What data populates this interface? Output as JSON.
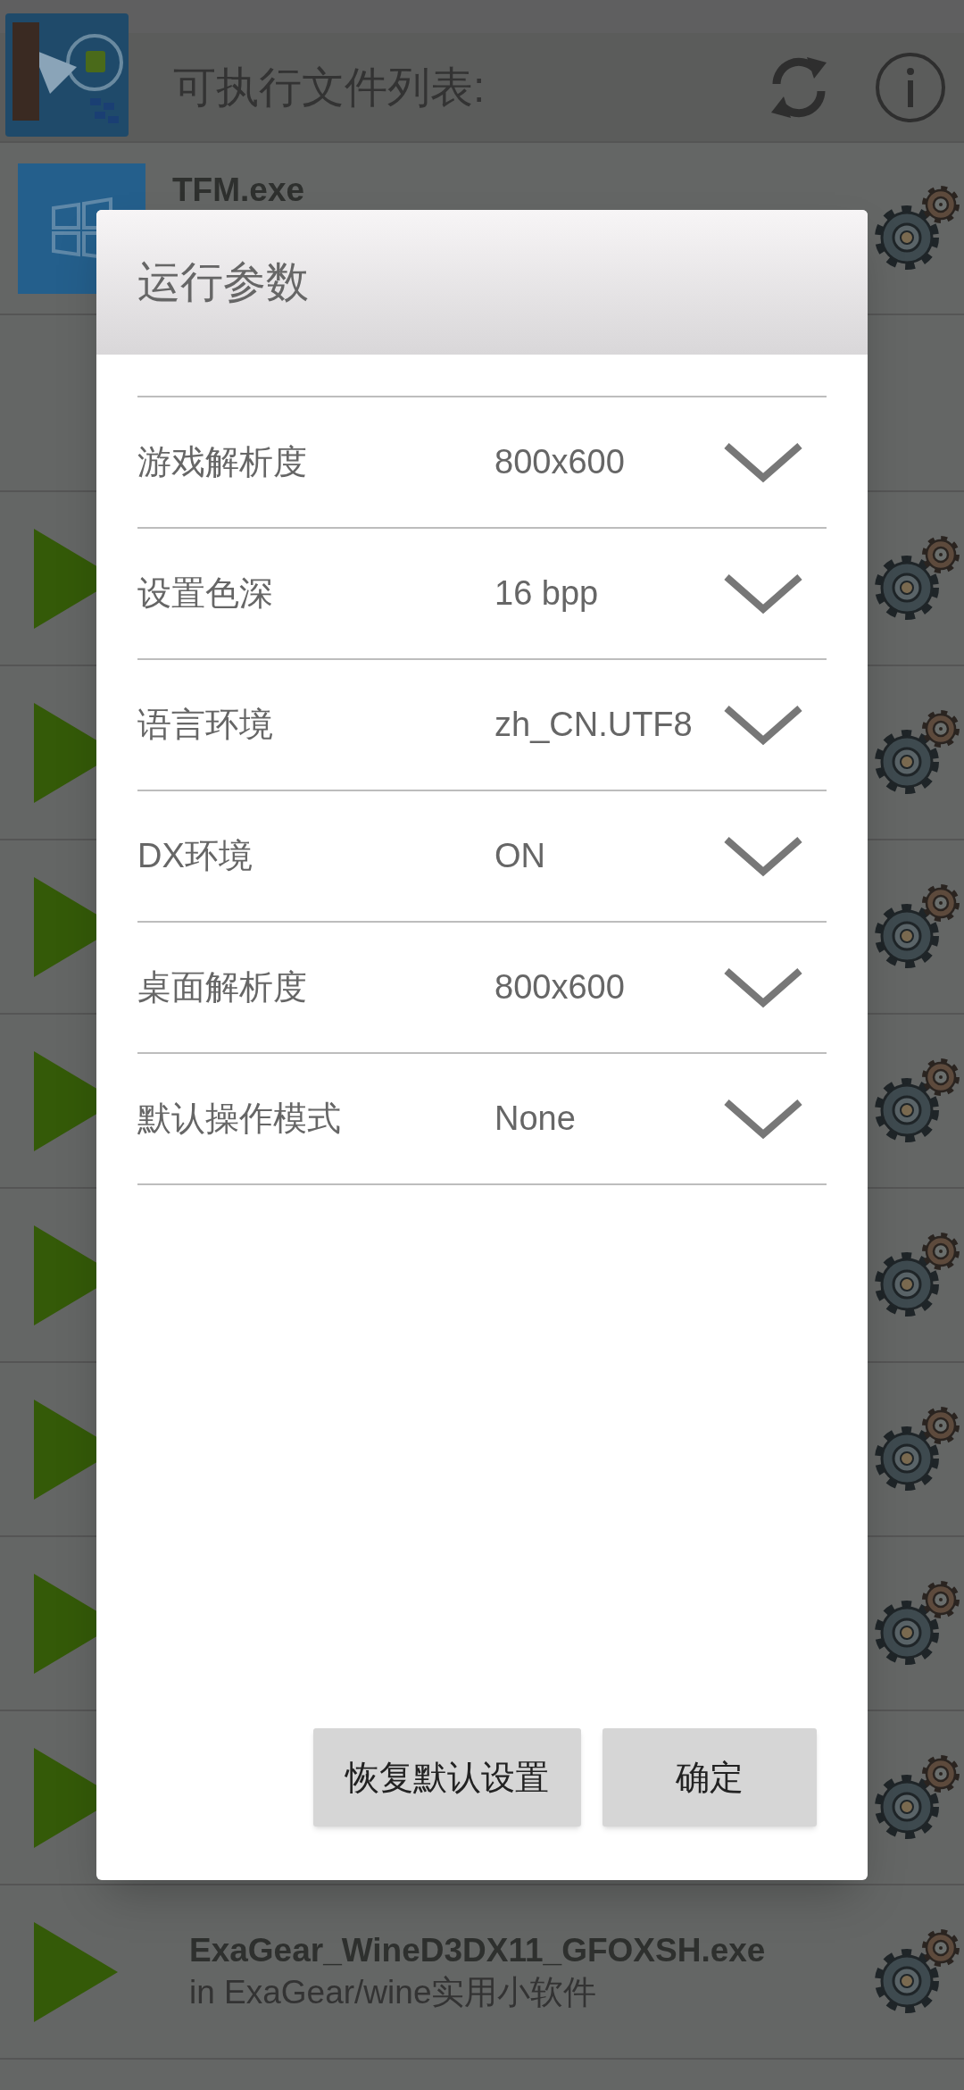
{
  "header": {
    "title": "可执行文件列表:"
  },
  "list": [
    {
      "kind": "app",
      "name": "TFM.exe"
    },
    {
      "kind": "blank"
    },
    {
      "kind": "play"
    },
    {
      "kind": "play"
    },
    {
      "kind": "play"
    },
    {
      "kind": "play"
    },
    {
      "kind": "play"
    },
    {
      "kind": "play"
    },
    {
      "kind": "play"
    },
    {
      "kind": "play"
    },
    {
      "kind": "play",
      "name": "ExaGear_WineD3DX11_GFOXSH.exe",
      "location": "in ExaGear/wine实用小软件"
    }
  ],
  "dialog": {
    "title": "运行参数",
    "settings": [
      {
        "label": "游戏解析度",
        "value": "800x600"
      },
      {
        "label": "设置色深",
        "value": "16 bpp"
      },
      {
        "label": "语言环境",
        "value": "zh_CN.UTF8"
      },
      {
        "label": "DX环境",
        "value": "ON"
      },
      {
        "label": "桌面解析度",
        "value": "800x600"
      },
      {
        "label": "默认操作模式",
        "value": "None"
      }
    ],
    "buttons": [
      "恢复默认设置",
      "确定"
    ]
  }
}
